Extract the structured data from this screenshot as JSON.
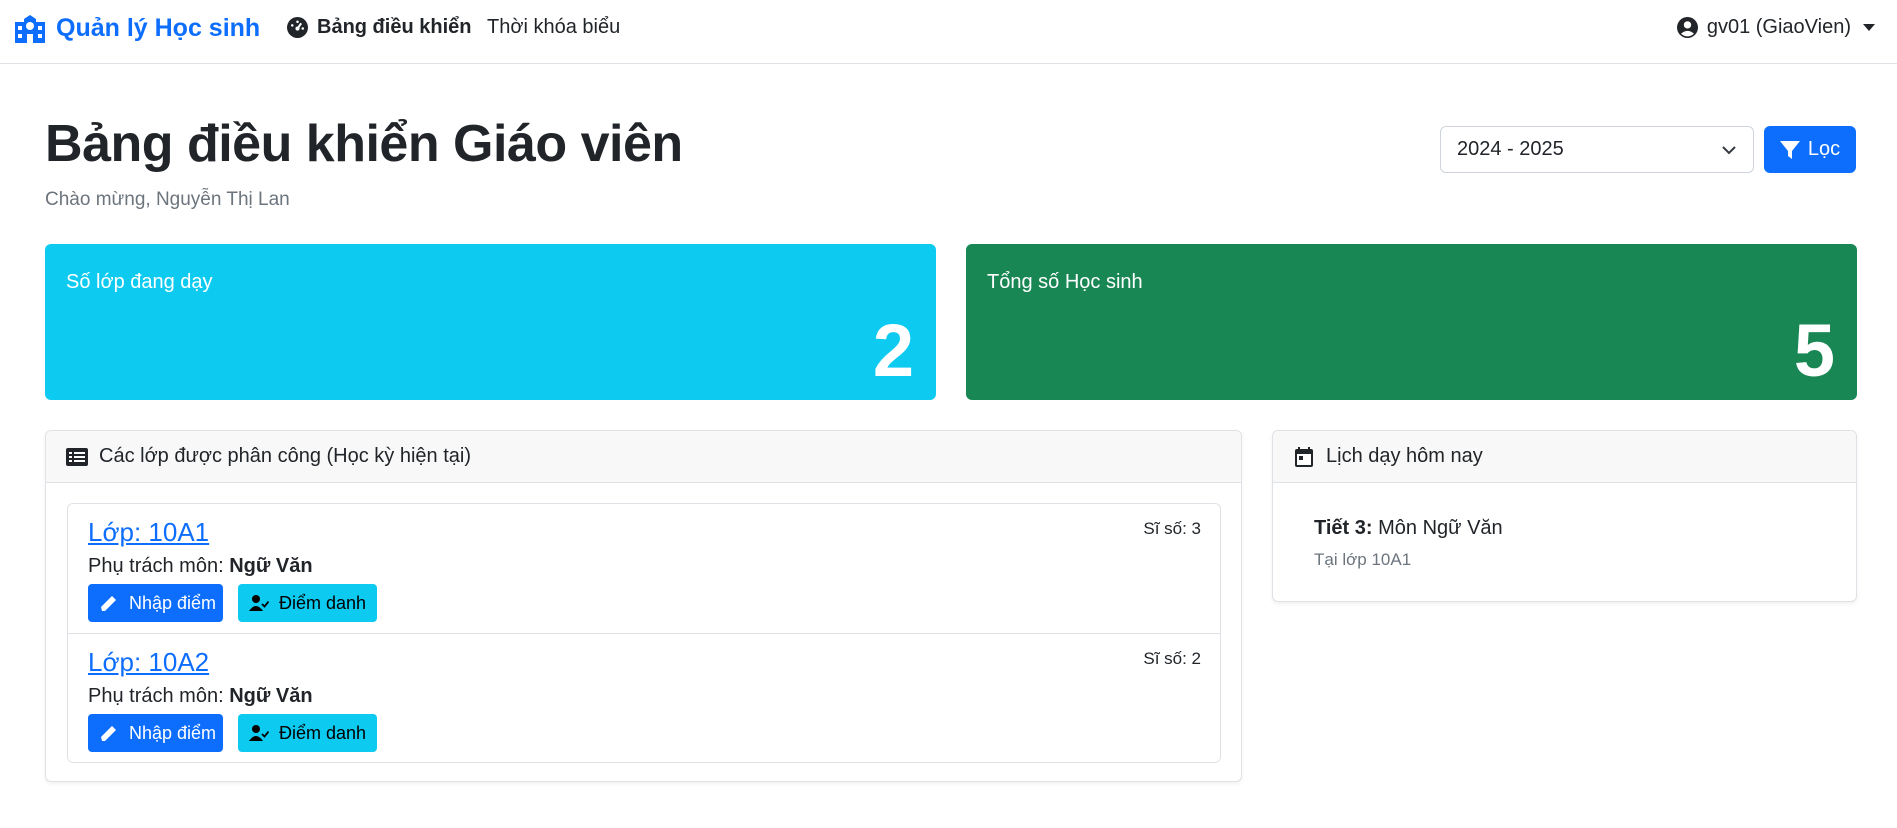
{
  "nav": {
    "brand": "Quản lý Học sinh",
    "links": [
      {
        "label": "Bảng điều khiển",
        "icon": "dashboard-icon",
        "active": true
      },
      {
        "label": "Thời khóa biểu",
        "active": false
      }
    ],
    "user": "gv01 (GiaoVien)"
  },
  "header": {
    "title": "Bảng điều khiển Giáo viên",
    "welcome": "Chào mừng, Nguyễn Thị Lan",
    "year_select": "2024 - 2025",
    "filter_label": "Lọc"
  },
  "stats": {
    "teaching": {
      "label": "Số lớp đang dạy",
      "value": "2",
      "color": "#0dcaf0"
    },
    "students": {
      "label": "Tổng số Học sinh",
      "value": "5",
      "color": "#198754"
    }
  },
  "classes_panel": {
    "title": "Các lớp được phân công (Học kỳ hiện tại)",
    "items": [
      {
        "name": "Lớp: 10A1",
        "size": "Sĩ số: 3",
        "subject_label": "Phụ trách môn:",
        "subject": "Ngữ Văn",
        "grade_label": "Nhập điểm",
        "attend_label": "Điểm danh"
      },
      {
        "name": "Lớp: 10A2",
        "size": "Sĩ số: 2",
        "subject_label": "Phụ trách môn:",
        "subject": "Ngữ Văn",
        "grade_label": "Nhập điểm",
        "attend_label": "Điểm danh"
      }
    ]
  },
  "schedule_panel": {
    "title": "Lịch dạy hôm nay",
    "entries": [
      {
        "period": "Tiết 3:",
        "subject": "Môn Ngữ Văn",
        "room": "Tại lớp 10A1"
      }
    ]
  },
  "colors": {
    "primary": "#0d6efd",
    "info": "#0dcaf0",
    "success": "#198754"
  }
}
